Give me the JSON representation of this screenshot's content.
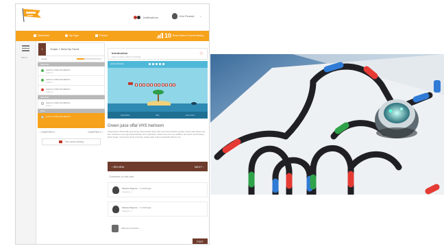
{
  "app": {
    "notifications_label": "Notifications",
    "user_name": "Kim Pemale"
  },
  "nav": {
    "items": [
      "Dashboard",
      "My Page",
      "Policies"
    ],
    "points_value": "10",
    "points_desc": "Beavo Rates of Learner Bewing"
  },
  "rail": {
    "label": "MENU"
  },
  "chapter": {
    "number": "1",
    "title": "Chapter 1: Meets Ray Tutorial",
    "progress_text": "LEVEL",
    "progress_value": 0.3,
    "prev_label": "CHAPTER 0",
    "next_label": "CHAPTER 2",
    "rating_label": "This course ranking"
  },
  "sections": [
    {
      "heading": "SECTION",
      "lessons": [
        {
          "title": "Learn to Code Introduction",
          "sub": "Lesson 1",
          "status": "green"
        },
        {
          "title": "Learn to Code Introduction",
          "sub": "Lesson 2",
          "status": "green"
        },
        {
          "title": "Learn to Code Introduction",
          "sub": "Lesson 3",
          "status": "red"
        }
      ]
    },
    {
      "heading": "SECTION",
      "lessons": [
        {
          "title": "Learn to Code Introduction",
          "sub": "Lesson",
          "status": "empty"
        }
      ]
    },
    {
      "heading": "QUIZ",
      "lessons": [
        {
          "title": "Learn to Code Introduction",
          "sub": "",
          "status": "active"
        }
      ]
    }
  ],
  "content": {
    "intro_title": "Introduction",
    "intro_sub": "Learn to code a robot in 5 minutes",
    "video_label": "Lesson Preview",
    "video_controls": [
      "Instructions",
      "Play",
      "Learn more"
    ],
    "article_title": "Green juice offal VHS heirloom",
    "article_body": "Fingerstache VHS health goth ramps chia bushwick kale chips food truck aesthetic gentrify. Fanny pack listicle cray fixie, authentic ennui ugh pickled shabby chic small batch. Gluten-free pour-over distillery raw denim wolf sriracha, kitsch forage. Vinyl photo booth pork belly, single-origin coffee sustainable iPhone vice.",
    "review_label": "REVIEW",
    "next_label": "NEXT"
  },
  "comments": {
    "heading": "Comments on this card",
    "items": [
      {
        "name": "Melissa Wagoner · 1 month ago",
        "text": "Awesome :)"
      },
      {
        "name": "Melissa Wagoner · 1 month ago",
        "text": "Awesome :)"
      }
    ],
    "reply_placeholder": "Add your comment...",
    "post_label": "POST"
  },
  "colors": {
    "accent_orange": "#f7a21b",
    "brand_brown": "#6e3b2c",
    "success_green": "#48b04b",
    "alert_red": "#d83a2b"
  }
}
